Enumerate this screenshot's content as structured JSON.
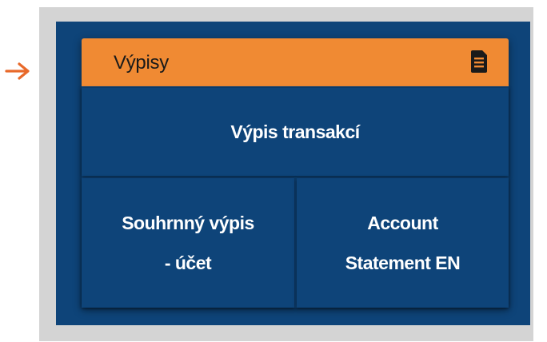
{
  "widget": {
    "title": "Výpisy",
    "header_color": "#f08a33",
    "header_icon": "document-icon"
  },
  "tiles": {
    "transactions": "Výpis transakcí",
    "summary_line1": "Souhrnný výpis",
    "summary_line2": "- účet",
    "account_line1": "Account",
    "account_line2": "Statement EN"
  },
  "colors": {
    "panel": "#0e4479",
    "frame": "#d4d4d4",
    "arrow": "#e8692a"
  }
}
